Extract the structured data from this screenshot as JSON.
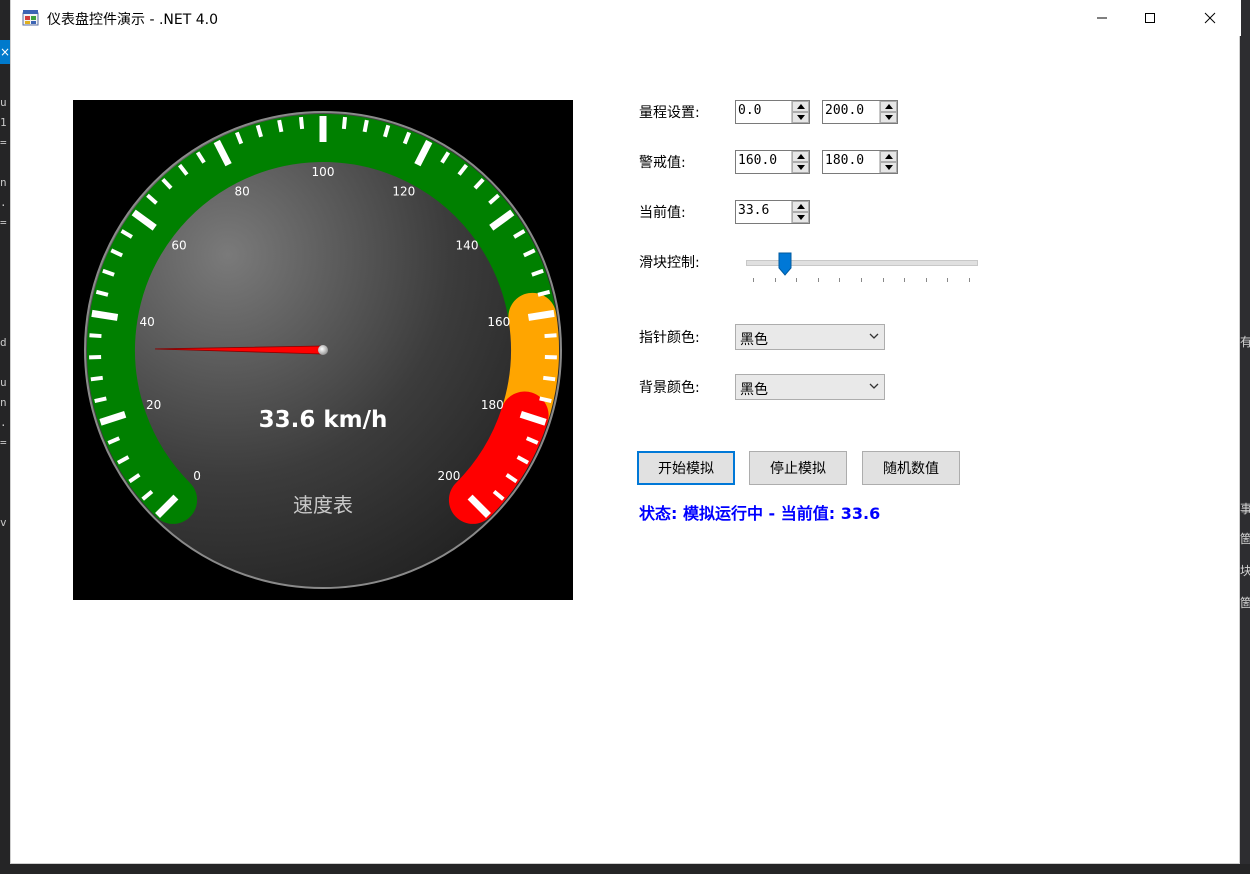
{
  "window": {
    "title": "仪表盘控件演示 - .NET 4.0"
  },
  "gauge": {
    "min": 0,
    "max": 200,
    "warning_from": 160,
    "warning_to": 180,
    "value": 33.6,
    "value_text": "33.6 km/h",
    "caption": "速度表",
    "scale_labels": [
      "0",
      "20",
      "40",
      "60",
      "80",
      "100",
      "120",
      "140",
      "160",
      "180",
      "200"
    ],
    "colors": {
      "normal": "#008000",
      "warning": "#ffa500",
      "danger": "#ff0000",
      "needle": "#ff0000",
      "background": "#000000"
    }
  },
  "settings": {
    "range_label": "量程设置:",
    "range_min": "0.0",
    "range_max": "200.0",
    "warning_label": "警戒值:",
    "warning_min": "160.0",
    "warning_max": "180.0",
    "current_label": "当前值:",
    "current_value": "33.6",
    "slider_label": "滑块控制:",
    "slider_value": 0.168,
    "needle_color_label": "指针颜色:",
    "needle_color_value": "黑色",
    "bg_color_label": "背景颜色:",
    "bg_color_value": "黑色"
  },
  "buttons": {
    "start": "开始模拟",
    "stop": "停止模拟",
    "random": "随机数值"
  },
  "status": "状态: 模拟运行中 - 当前值: 33.6"
}
